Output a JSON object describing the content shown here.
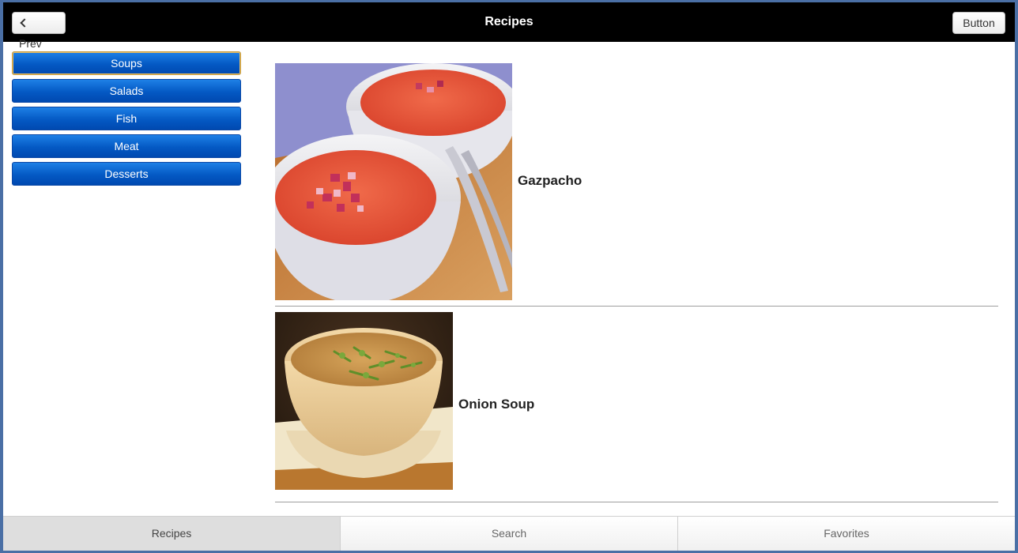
{
  "header": {
    "title": "Recipes",
    "prev_label": "Prev",
    "right_button_label": "Button"
  },
  "sidebar": {
    "categories": [
      {
        "label": "Soups",
        "active": true
      },
      {
        "label": "Salads",
        "active": false
      },
      {
        "label": "Fish",
        "active": false
      },
      {
        "label": "Meat",
        "active": false
      },
      {
        "label": "Desserts",
        "active": false
      }
    ]
  },
  "recipes": [
    {
      "name": "Gazpacho",
      "image": "gazpacho-photo"
    },
    {
      "name": "Onion Soup",
      "image": "onion-soup-photo"
    }
  ],
  "tabs": [
    {
      "label": "Recipes",
      "active": true
    },
    {
      "label": "Search",
      "active": false
    },
    {
      "label": "Favorites",
      "active": false
    }
  ],
  "colors": {
    "header_bg": "#000000",
    "category_button": "#0459c4",
    "active_outline": "#c79a3a"
  }
}
